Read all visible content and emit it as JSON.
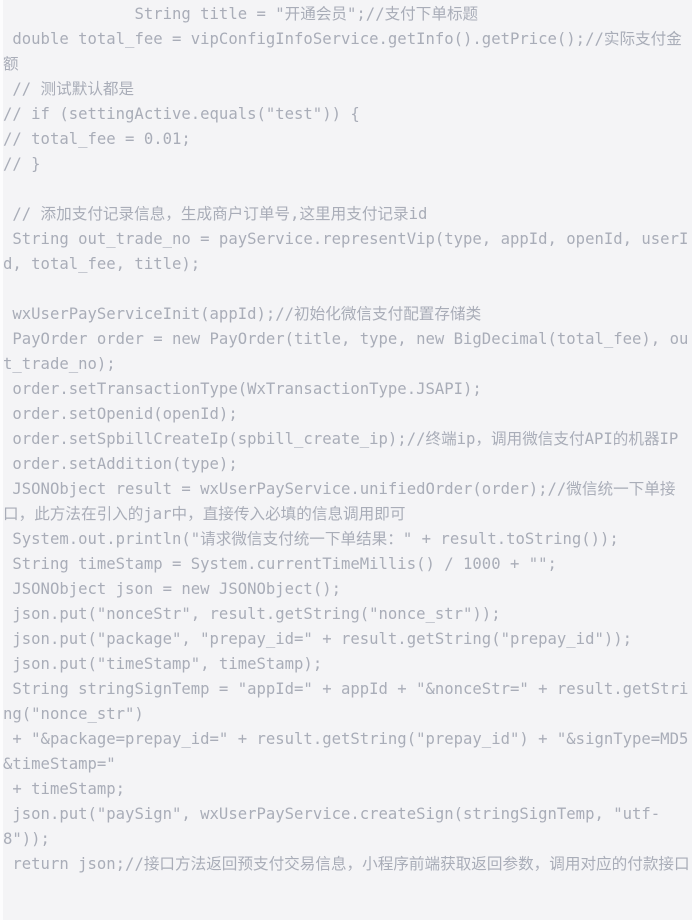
{
  "viewer": {
    "type": "code-snippet-image",
    "language": "java",
    "background_color": "#f4f4f6",
    "text_color": "#a9adb8",
    "left_edge_color": "#fcfcfd",
    "font_size_px": 15.6,
    "line_height_px": 25
  },
  "code": {
    "lines": [
      "              String title = \"开通会员\";//支付下单标题",
      " double total_fee = vipConfigInfoService.getInfo().getPrice();//实际支付金额",
      " // 测试默认都是",
      "// if (settingActive.equals(\"test\")) {",
      "// total_fee = 0.01;",
      "// }",
      "",
      " // 添加支付记录信息，生成商户订单号,这里用支付记录id",
      " String out_trade_no = payService.representVip(type, appId, openId, userId, total_fee, title);",
      "",
      " wxUserPayServiceInit(appId);//初始化微信支付配置存储类",
      " PayOrder order = new PayOrder(title, type, new BigDecimal(total_fee), out_trade_no);",
      " order.setTransactionType(WxTransactionType.JSAPI);",
      " order.setOpenid(openId);",
      " order.setSpbillCreateIp(spbill_create_ip);//终端ip，调用微信支付API的机器IP",
      " order.setAddition(type);",
      " JSONObject result = wxUserPayService.unifiedOrder(order);//微信统一下单接口，此方法在引入的jar中，直接传入必填的信息调用即可",
      " System.out.println(\"请求微信支付统一下单结果：\" + result.toString());",
      " String timeStamp = System.currentTimeMillis() / 1000 + \"\";",
      " JSONObject json = new JSONObject();",
      " json.put(\"nonceStr\", result.getString(\"nonce_str\"));",
      " json.put(\"package\", \"prepay_id=\" + result.getString(\"prepay_id\"));",
      " json.put(\"timeStamp\", timeStamp);",
      " String stringSignTemp = \"appId=\" + appId + \"&nonceStr=\" + result.getString(\"nonce_str\")",
      " + \"&package=prepay_id=\" + result.getString(\"prepay_id\") + \"&signType=MD5&timeStamp=\"",
      " + timeStamp;",
      " json.put(\"paySign\", wxUserPayService.createSign(stringSignTemp, \"utf-8\"));",
      " return json;//接口方法返回预支付交易信息，小程序前端获取返回参数，调用对应的付款接口"
    ]
  }
}
